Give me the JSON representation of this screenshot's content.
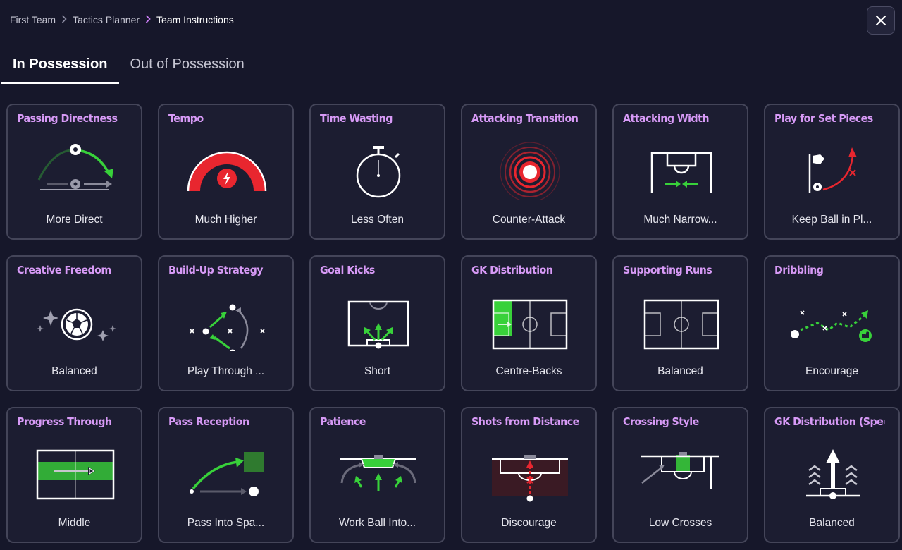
{
  "breadcrumb": {
    "items": [
      "First Team",
      "Tactics Planner",
      "Team Instructions"
    ]
  },
  "tabs": [
    {
      "label": "In Possession",
      "active": true
    },
    {
      "label": "Out of Possession",
      "active": false
    }
  ],
  "colors": {
    "title": "#d79af6",
    "accent_green": "#38d13a",
    "accent_red": "#e8262f"
  },
  "cards": [
    {
      "title": "Passing Directness",
      "value": "More Direct",
      "icon": "passing-directness-icon"
    },
    {
      "title": "Tempo",
      "value": "Much Higher",
      "icon": "tempo-gauge-icon"
    },
    {
      "title": "Time Wasting",
      "value": "Less Often",
      "icon": "stopwatch-icon"
    },
    {
      "title": "Attacking Transition",
      "value": "Counter-Attack",
      "icon": "target-rings-icon"
    },
    {
      "title": "Attacking Width",
      "value": "Much Narrow...",
      "icon": "narrow-width-icon"
    },
    {
      "title": "Play for Set Pieces",
      "value": "Keep Ball in Pl...",
      "icon": "set-piece-flag-icon"
    },
    {
      "title": "Creative Freedom",
      "value": "Balanced",
      "icon": "sparkle-ball-icon"
    },
    {
      "title": "Build-Up Strategy",
      "value": "Play Through ...",
      "icon": "build-up-icon"
    },
    {
      "title": "Goal Kicks",
      "value": "Short",
      "icon": "goal-kick-short-icon"
    },
    {
      "title": "GK Distribution",
      "value": "Centre-Backs",
      "icon": "gk-distribution-pitch-icon"
    },
    {
      "title": "Supporting Runs",
      "value": "Balanced",
      "icon": "supporting-runs-pitch-icon"
    },
    {
      "title": "Dribbling",
      "value": "Encourage",
      "icon": "dribbling-icon"
    },
    {
      "title": "Progress Through",
      "value": "Middle",
      "icon": "progress-middle-icon"
    },
    {
      "title": "Pass Reception",
      "value": "Pass Into Spa...",
      "icon": "pass-into-space-icon"
    },
    {
      "title": "Patience",
      "value": "Work Ball Into...",
      "icon": "patience-box-icon"
    },
    {
      "title": "Shots from Distance",
      "value": "Discourage",
      "icon": "shots-distance-icon"
    },
    {
      "title": "Crossing Style",
      "value": "Low Crosses",
      "icon": "low-crosses-icon"
    },
    {
      "title": "GK Distribution (Speed)",
      "value": "Balanced",
      "icon": "gk-speed-arrows-icon"
    }
  ]
}
